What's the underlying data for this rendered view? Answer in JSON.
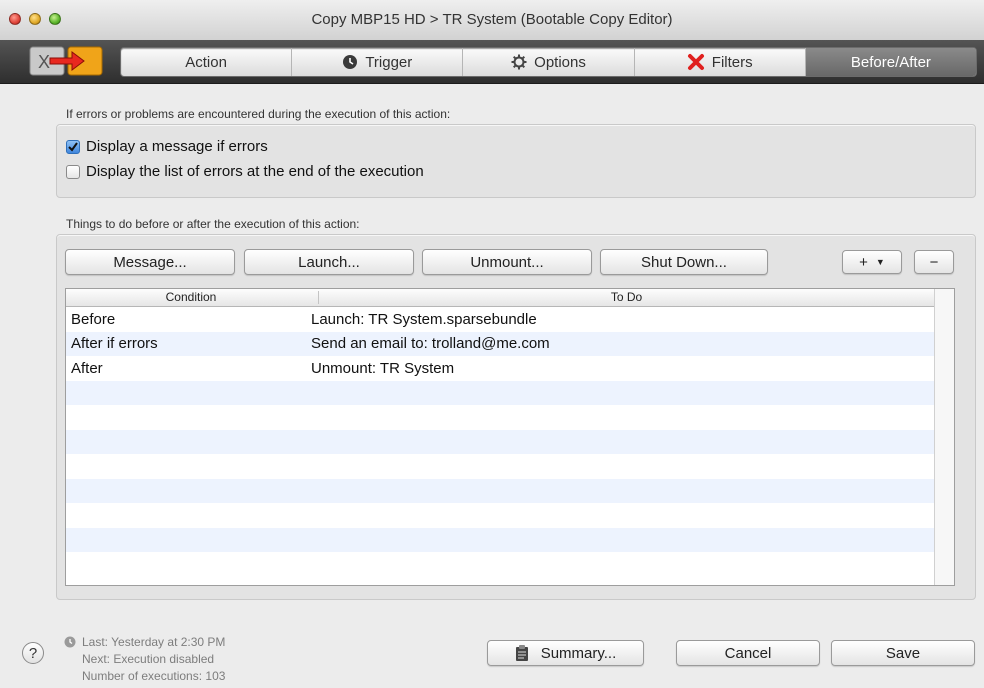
{
  "window": {
    "title": "Copy MBP15 HD > TR System (Bootable Copy Editor)"
  },
  "toolbar": {
    "tabs": [
      {
        "label": "Action",
        "icon": "none",
        "active": false
      },
      {
        "label": "Trigger",
        "icon": "clock-icon",
        "active": false
      },
      {
        "label": "Options",
        "icon": "gear-icon",
        "active": false
      },
      {
        "label": "Filters",
        "icon": "red-x-icon",
        "active": false
      },
      {
        "label": "Before/After",
        "icon": "none",
        "active": true
      }
    ]
  },
  "errors": {
    "heading": "If errors or problems are encountered during the execution of this action:",
    "options": [
      {
        "label": "Display a message if errors",
        "checked": true
      },
      {
        "label": "Display the list of errors at the end of the execution",
        "checked": false
      }
    ]
  },
  "things": {
    "heading": "Things to do before or after the execution of this action:",
    "buttons": [
      "Message...",
      "Launch...",
      "Unmount...",
      "Shut Down..."
    ],
    "add_label": "+",
    "remove_label": "−",
    "columns": [
      "Condition",
      "To Do"
    ],
    "rows": [
      {
        "condition": "Before",
        "todo": "Launch: TR System.sparsebundle"
      },
      {
        "condition": "After if errors",
        "todo": "Send an email to: trolland@me.com"
      },
      {
        "condition": "After",
        "todo": "Unmount: TR System"
      }
    ]
  },
  "footer": {
    "help": "?",
    "status": [
      "Last: Yesterday at 2:30 PM",
      "Next: Execution disabled",
      "Number of executions: 103"
    ],
    "summary": "Summary...",
    "cancel": "Cancel",
    "save": "Save"
  },
  "colors": {
    "accent": "#3f86dd",
    "toolbar": "#3c3c3c",
    "row_alt": "#edf3fe",
    "filters_x": "#e0201e"
  }
}
